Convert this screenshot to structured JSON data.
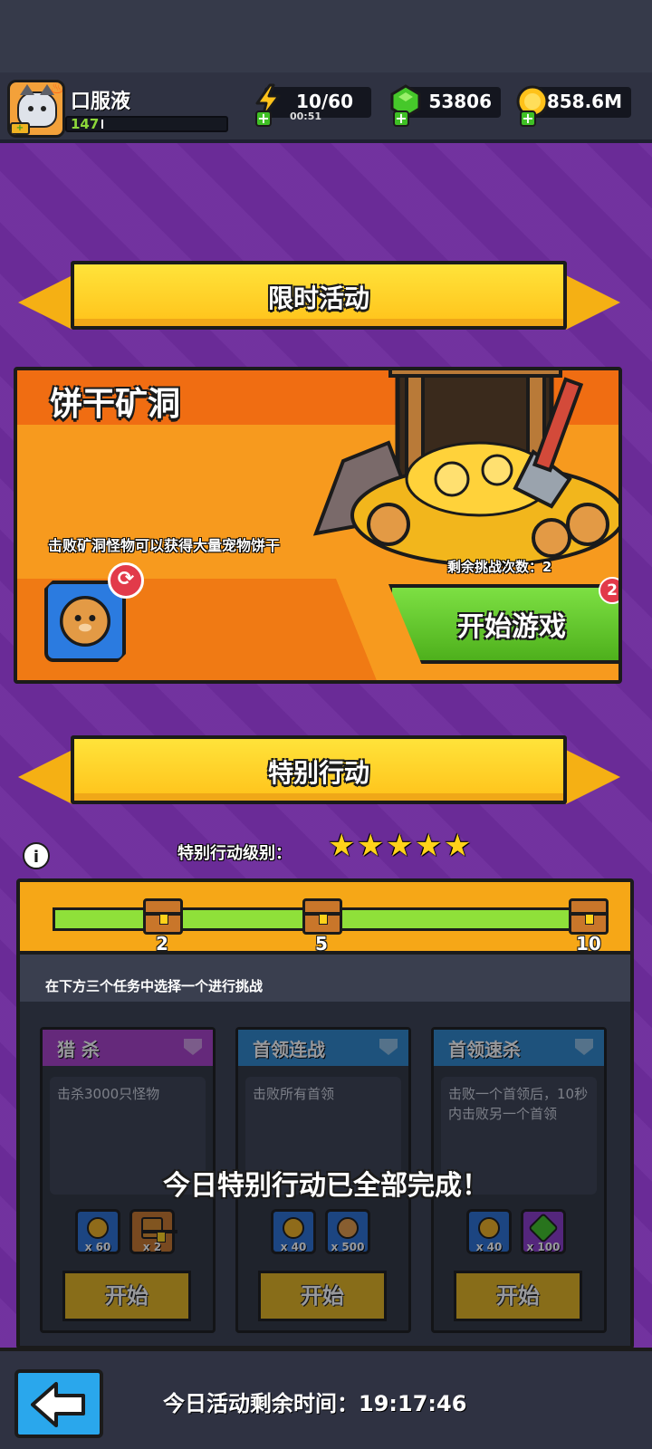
{
  "player": {
    "name": "口服液",
    "level": "147"
  },
  "resources": {
    "energy": "10/60",
    "energy_timer": "00:51",
    "gems": "53806",
    "gold": "858.6M"
  },
  "limited_event": {
    "banner_title": "限时活动",
    "title": "饼干矿洞",
    "description": "击败矿洞怪物可以获得大量宠物饼干",
    "remaining_attempts": "剩余挑战次数：2",
    "start_button": "开始游戏",
    "badge_count": "2",
    "refresh_icon": "⟳"
  },
  "special_action": {
    "banner_title": "特别行动",
    "info_icon": "i",
    "level_label": "特别行动级别：",
    "stars": 5,
    "milestones": [
      "2",
      "5",
      "10"
    ],
    "instruction": "在下方三个任务中选择一个进行挑战",
    "tasks": [
      {
        "title": "猎 杀",
        "description": "击杀3000只怪物",
        "rewards": [
          {
            "icon": "gold-coin-icon",
            "qty": "x 60"
          },
          {
            "icon": "chest-icon",
            "qty": "x 2"
          }
        ],
        "start_label": "开始"
      },
      {
        "title": "首领连战",
        "description": "击败所有首领",
        "rewards": [
          {
            "icon": "gold-coin-icon",
            "qty": "x 40"
          },
          {
            "icon": "cookie-icon",
            "qty": "x 500"
          }
        ],
        "start_label": "开始"
      },
      {
        "title": "首领速杀",
        "description": "击败一个首领后，10秒内击败另一个首领",
        "rewards": [
          {
            "icon": "gold-coin-icon",
            "qty": "x 40"
          },
          {
            "icon": "gem-icon",
            "qty": "x 100"
          }
        ],
        "start_label": "开始"
      }
    ],
    "completed_message": "今日特别行动已全部完成！"
  },
  "footer": {
    "remaining_time": "今日活动剩余时间：19:17:46"
  },
  "colors": {
    "background": "#6d2c9c",
    "banner_yellow": "#ffd21a",
    "event_orange": "#f79a1e",
    "start_green": "#5ec42a",
    "task_purple": "#a73fc7",
    "task_blue": "#2e86c8"
  }
}
